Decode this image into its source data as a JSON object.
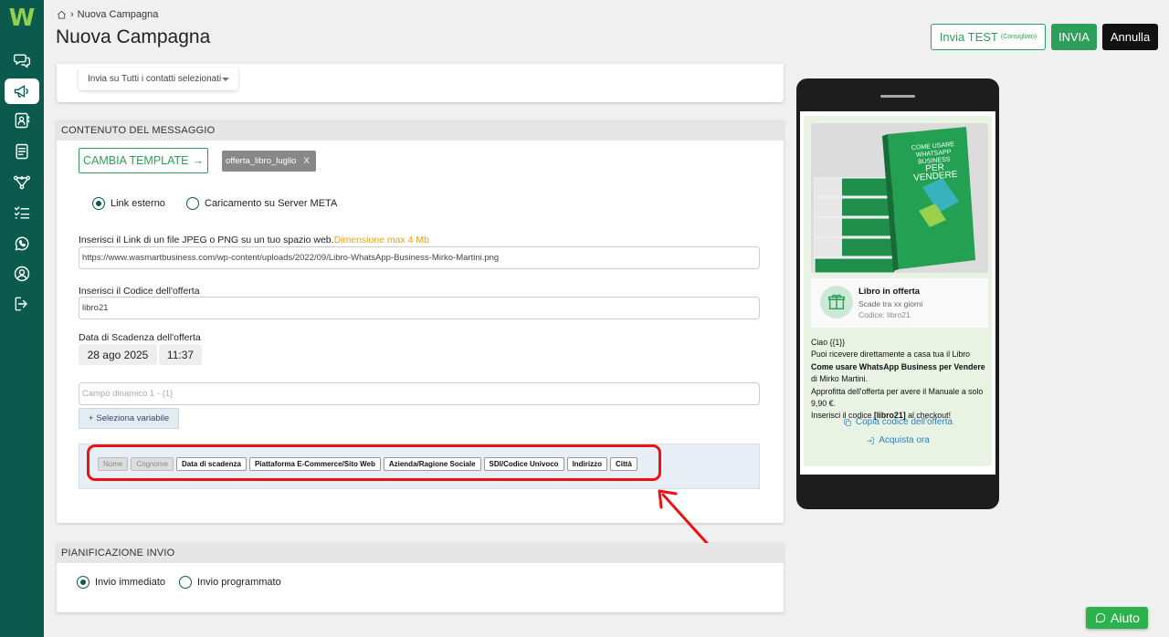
{
  "breadcrumb": {
    "current": "Nuova Campagna"
  },
  "header": {
    "title": "Nuova Campagna",
    "btn_test": "Invia TEST",
    "btn_test_hint": "(Consigliato)",
    "btn_send": "INVIA",
    "btn_cancel": "Annulla"
  },
  "sidebar": {
    "logo": "W",
    "items": [
      "chat-icon",
      "megaphone-icon",
      "contacts-icon",
      "document-icon",
      "flow-icon",
      "checklist-icon",
      "whatsapp-icon",
      "user-icon",
      "logout-icon"
    ]
  },
  "recipients": {
    "select_value": "Invia su Tutti i contatti selezionati"
  },
  "message": {
    "section_title": "CONTENUTO DEL MESSAGGIO",
    "change_template": "CAMBIA TEMPLATE",
    "template_tag": "offerta_libro_luglio",
    "template_tag_close": "X",
    "radio_external": "Link esterno",
    "radio_upload": "Caricamento su Server META",
    "link_label": "Inserisci il Link di un file JPEG o PNG su un tuo spazio web.",
    "link_note": "Dimensione max 4 Mb",
    "link_value": "https://www.wasmartbusiness.com/wp-content/uploads/2022/09/Libro-WhatsApp-Business-Mirko-Martini.png",
    "code_label": "Inserisci il Codice dell'offerta",
    "code_value": "libro21",
    "expiry_label": "Data di Scadenza dell'offerta",
    "expiry_date": "28 ago 2025",
    "expiry_time": "11:37",
    "dynamic_placeholder": "Campo dinamico 1 - {1}",
    "select_variable": "Seleziona variabile",
    "variables": [
      {
        "label": "Nome",
        "disabled": true
      },
      {
        "label": "Cognome",
        "disabled": true
      },
      {
        "label": "Data di scadenza",
        "disabled": false
      },
      {
        "label": "Piattaforma E-Commerce/Sito Web",
        "disabled": false
      },
      {
        "label": "Azienda/Ragione Sociale",
        "disabled": false
      },
      {
        "label": "SDI/Codice Univoco",
        "disabled": false
      },
      {
        "label": "Indirizzo",
        "disabled": false
      },
      {
        "label": "Città",
        "disabled": false
      }
    ]
  },
  "planning": {
    "section_title": "PIANIFICAZIONE INVIO",
    "radio_now": "Invio immediato",
    "radio_scheduled": "Invio programmato"
  },
  "preview": {
    "offer_title": "Libro in offerta",
    "offer_expiry": "Scade tra xx giorni",
    "offer_code": "Codice: libro21",
    "greeting": "Ciao {{1}}",
    "line1": "Puoi ricevere direttamente a casa tua il Libro",
    "book_title": "Come usare WhatsApp Business per Vendere",
    "line2": " di Mirko Martini.",
    "line3": "Approfitta dell'offerta per avere il Manuale a solo 9,90 €.",
    "line4_pre": "Inserisci il codice ",
    "line4_code": "[libro21]",
    "line4_post": " al checkout!",
    "copy_code": "Copia codice dell'offerta",
    "buy_now": "Acquista ora",
    "book_cover_title": "COME USARE WHATSAPP BUSINESS",
    "book_cover_sub": "PER VENDERE"
  },
  "help": {
    "label": "Aiuto"
  },
  "colors": {
    "brand": "#0b5a4d",
    "accent": "#2e9f5b",
    "highlight": "#e11111",
    "link": "#2f7fbf"
  }
}
